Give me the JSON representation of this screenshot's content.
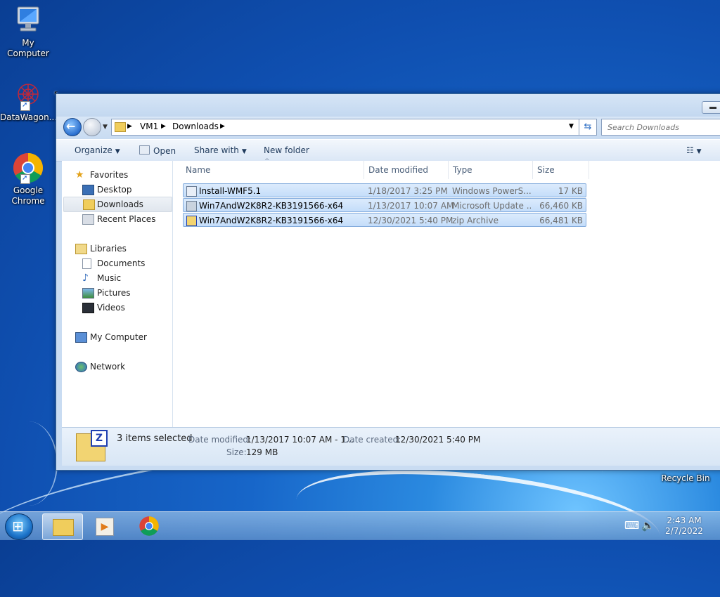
{
  "desktop": {
    "icons": [
      {
        "label": "My Computer"
      },
      {
        "label": "DataWagon..."
      },
      {
        "label": "Google Chrome"
      },
      {
        "label": "Recycle Bin"
      }
    ]
  },
  "address_bar": {
    "crumbs": [
      "VM1",
      "Downloads"
    ],
    "search_placeholder": "Search Downloads"
  },
  "toolbar": {
    "organize": "Organize",
    "open": "Open",
    "share_with": "Share with",
    "new_folder": "New folder"
  },
  "nav": {
    "favorites": "Favorites",
    "desktop": "Desktop",
    "downloads": "Downloads",
    "recent_places": "Recent Places",
    "libraries": "Libraries",
    "documents": "Documents",
    "music": "Music",
    "pictures": "Pictures",
    "videos": "Videos",
    "my_computer": "My Computer",
    "network": "Network"
  },
  "columns": {
    "name": "Name",
    "date_modified": "Date modified",
    "type": "Type",
    "size": "Size"
  },
  "files": [
    {
      "name": "Install-WMF5.1",
      "date": "1/18/2017 3:25 PM",
      "type": "Windows PowerS...",
      "size": "17 KB"
    },
    {
      "name": "Win7AndW2K8R2-KB3191566-x64",
      "date": "1/13/2017 10:07 AM",
      "type": "Microsoft Update ...",
      "size": "66,460 KB"
    },
    {
      "name": "Win7AndW2K8R2-KB3191566-x64",
      "date": "12/30/2021 5:40 PM",
      "type": "zip Archive",
      "size": "66,481 KB"
    }
  ],
  "details": {
    "selected_text": "3 items selected",
    "date_modified_label": "Date modified:",
    "date_modified_value": "1/13/2017 10:07 AM - 1...",
    "date_created_label": "Date created:",
    "date_created_value": "12/30/2021 5:40 PM",
    "size_label": "Size:",
    "size_value": "129 MB"
  },
  "taskbar": {
    "time": "2:43 AM",
    "date": "2/7/2022"
  }
}
